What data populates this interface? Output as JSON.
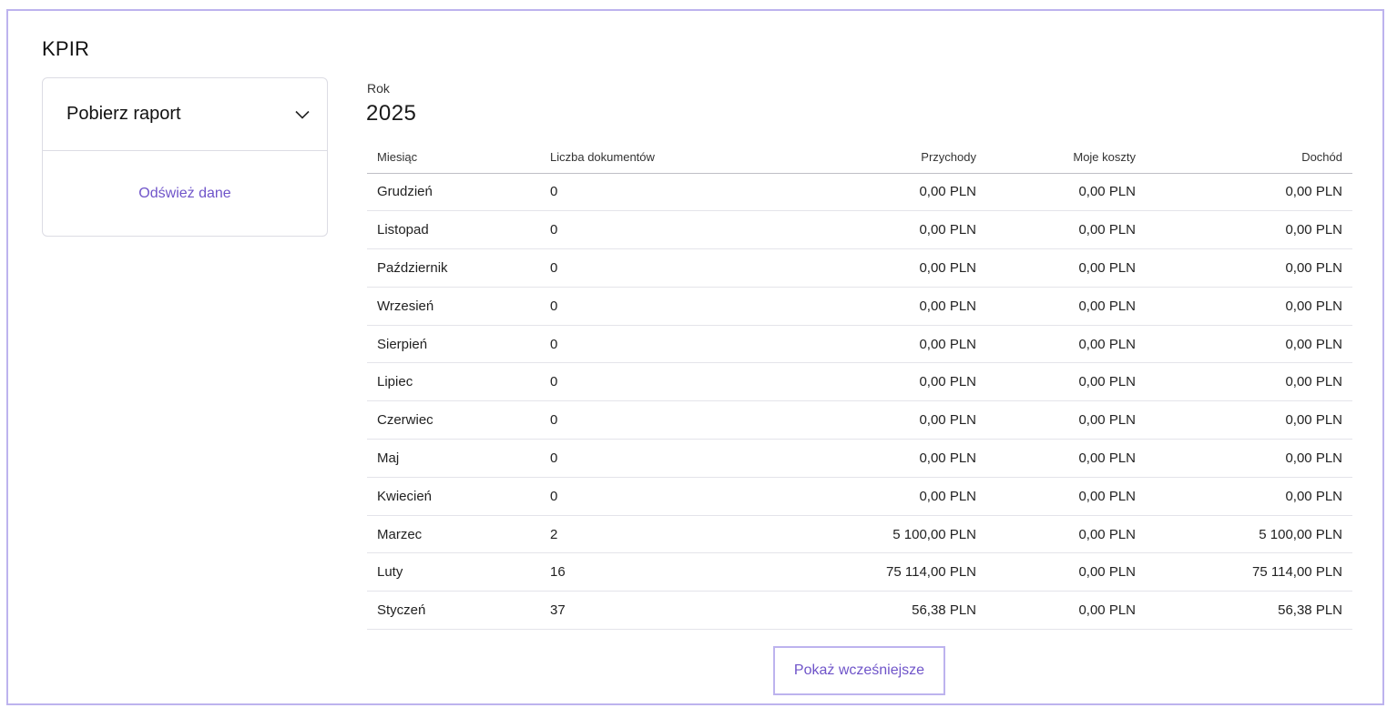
{
  "page": {
    "title": "KPIR"
  },
  "report_card": {
    "dropdown_label": "Pobierz raport",
    "refresh_label": "Odśwież dane"
  },
  "year": {
    "label": "Rok",
    "value": "2025"
  },
  "table": {
    "headers": [
      "Miesiąc",
      "Liczba dokumentów",
      "Przychody",
      "Moje koszty",
      "Dochód"
    ],
    "rows": [
      [
        "Grudzień",
        "0",
        "0,00 PLN",
        "0,00 PLN",
        "0,00 PLN"
      ],
      [
        "Listopad",
        "0",
        "0,00 PLN",
        "0,00 PLN",
        "0,00 PLN"
      ],
      [
        "Październik",
        "0",
        "0,00 PLN",
        "0,00 PLN",
        "0,00 PLN"
      ],
      [
        "Wrzesień",
        "0",
        "0,00 PLN",
        "0,00 PLN",
        "0,00 PLN"
      ],
      [
        "Sierpień",
        "0",
        "0,00 PLN",
        "0,00 PLN",
        "0,00 PLN"
      ],
      [
        "Lipiec",
        "0",
        "0,00 PLN",
        "0,00 PLN",
        "0,00 PLN"
      ],
      [
        "Czerwiec",
        "0",
        "0,00 PLN",
        "0,00 PLN",
        "0,00 PLN"
      ],
      [
        "Maj",
        "0",
        "0,00 PLN",
        "0,00 PLN",
        "0,00 PLN"
      ],
      [
        "Kwiecień",
        "0",
        "0,00 PLN",
        "0,00 PLN",
        "0,00 PLN"
      ],
      [
        "Marzec",
        "2",
        "5 100,00 PLN",
        "0,00 PLN",
        "5 100,00 PLN"
      ],
      [
        "Luty",
        "16",
        "75 114,00 PLN",
        "0,00 PLN",
        "75 114,00 PLN"
      ],
      [
        "Styczeń",
        "37",
        "56,38 PLN",
        "0,00 PLN",
        "56,38 PLN"
      ]
    ]
  },
  "show_more_label": "Pokaż wcześniejsze",
  "icons": {
    "dropdown": "chevron-down-icon"
  },
  "colors": {
    "accent": "#6f54c9",
    "frame": "#bdb3ee"
  }
}
